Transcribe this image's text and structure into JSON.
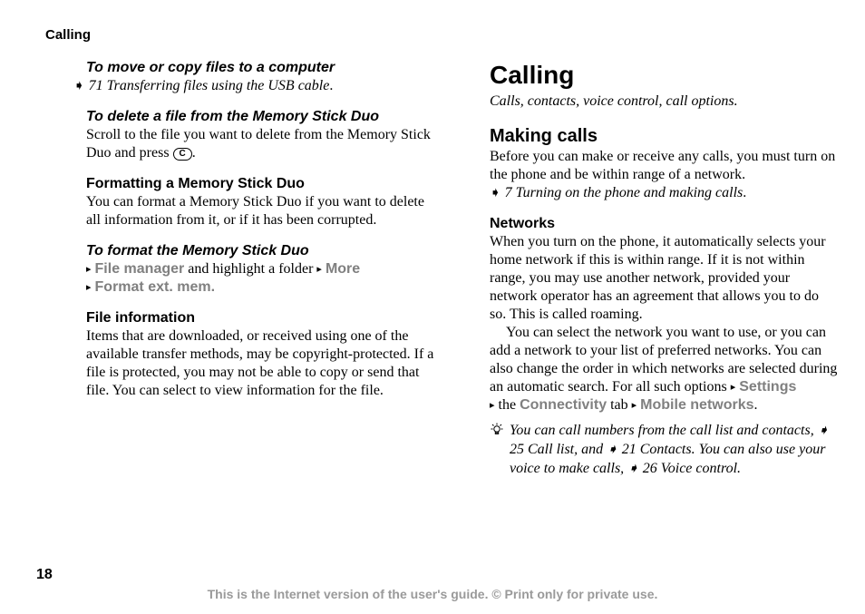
{
  "running_head": "Calling",
  "page_number": "18",
  "footer": "This is the Internet version of the user's guide. © Print only for private use.",
  "icons": {
    "key_c": "C",
    "arrow": "➧",
    "tri": "▸"
  },
  "left": {
    "h1": "To move or copy files to a computer",
    "ref1_page": "71",
    "ref1_text": "Transferring files using the USB cable",
    "h2": "To delete a file from the Memory Stick Duo",
    "p2a": "Scroll to the file you want to delete from the Memory Stick Duo and press ",
    "h3": "Formatting a Memory Stick Duo",
    "p3": "You can format a Memory Stick Duo if you want to delete all information from it, or if it has been corrupted.",
    "h4": "To format the Memory Stick Duo",
    "m1": "File manager",
    "m_mid": " and highlight a folder ",
    "m2": "More",
    "m3": "Format ext. mem.",
    "h5": "File information",
    "p5": "Items that are downloaded, or received using one of the available transfer methods, may be copyright-protected. If a file is protected, you may not be able to copy or send that file. You can select to view information for the file."
  },
  "right": {
    "h1": "Calling",
    "sub": "Calls, contacts, voice control, call options.",
    "h2": "Making calls",
    "p2": "Before you can make or receive any calls, you must turn on the phone and be within range of a network.",
    "ref2_page": "7",
    "ref2_text": "Turning on the phone and making calls",
    "h3": "Networks",
    "p3a": "When you turn on the phone, it automatically selects your home network if this is within range. If it is not within range, you may use another network, provided your network operator has an agreement that allows you to do so. This is called roaming.",
    "p3b_start": "You can select the network you want to use, or you can add a network to your list of preferred networks. You can also change the order in which networks are selected during an automatic search. For all such options ",
    "m_settings": "Settings",
    "m_the": " the ",
    "m_conn": "Connectivity",
    "m_tab": " tab ",
    "m_mob": "Mobile networks",
    "tip1": "You can call numbers from the call list and contacts, ",
    "tip_ref1_page": "25",
    "tip_ref1_text": "Call list",
    "tip_mid": ", and ",
    "tip_ref2_page": "21",
    "tip_ref2_text": "Contacts",
    "tip_end1": ". You can also use your voice to make calls, ",
    "tip_ref3_page": "26",
    "tip_ref3_text": "Voice control"
  }
}
